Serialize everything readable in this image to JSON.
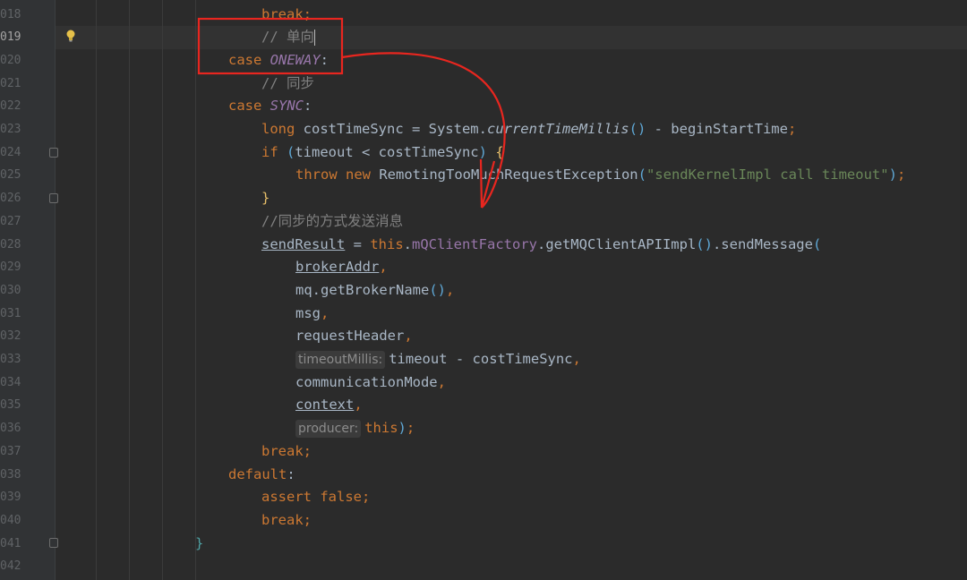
{
  "editor": {
    "lines": [
      {
        "num": "018",
        "segments": [
          {
            "t": "break",
            "c": "kw"
          },
          {
            "t": ";",
            "c": "kw"
          }
        ]
      },
      {
        "num": "019",
        "segments": [
          {
            "t": "// 单向",
            "c": "cm"
          }
        ]
      },
      {
        "num": "020",
        "segments": [
          {
            "t": "case ",
            "c": "kw"
          },
          {
            "t": "ONEWAY",
            "c": "fldi"
          },
          {
            "t": ":",
            "c": ""
          }
        ]
      },
      {
        "num": "021",
        "segments": [
          {
            "t": "// 同步",
            "c": "cm"
          }
        ]
      },
      {
        "num": "022",
        "segments": [
          {
            "t": "case ",
            "c": "kw"
          },
          {
            "t": "SYNC",
            "c": "fldi"
          },
          {
            "t": ":",
            "c": ""
          }
        ]
      },
      {
        "num": "023",
        "segments": [
          {
            "t": "long ",
            "c": "kw"
          },
          {
            "t": "costTimeSync = System.",
            "c": ""
          },
          {
            "t": "currentTimeMillis",
            "c": "mi"
          },
          {
            "t": "()",
            "c": "par2"
          },
          {
            "t": " - beginStartTime",
            "c": ""
          },
          {
            "t": ";",
            "c": "kw"
          }
        ]
      },
      {
        "num": "024",
        "segments": [
          {
            "t": "if ",
            "c": "kw"
          },
          {
            "t": "(",
            "c": "par2"
          },
          {
            "t": "timeout < costTimeSync",
            "c": ""
          },
          {
            "t": ")",
            "c": "par2"
          },
          {
            "t": " {",
            "c": "yel"
          }
        ]
      },
      {
        "num": "025",
        "segments": [
          {
            "t": "throw new ",
            "c": "kw"
          },
          {
            "t": "RemotingTooMuchRequestException",
            "c": ""
          },
          {
            "t": "(",
            "c": "par2"
          },
          {
            "t": "\"sendKernelImpl call timeout\"",
            "c": "st"
          },
          {
            "t": ")",
            "c": "par2"
          },
          {
            "t": ";",
            "c": "kw"
          }
        ]
      },
      {
        "num": "026",
        "segments": [
          {
            "t": "}",
            "c": "yel"
          }
        ]
      },
      {
        "num": "027",
        "segments": [
          {
            "t": "//同步的方式发送消息",
            "c": "cm"
          }
        ]
      },
      {
        "num": "028",
        "segments": [
          {
            "t": "sendResult",
            "c": "ul"
          },
          {
            "t": " = ",
            "c": ""
          },
          {
            "t": "this",
            "c": "kw"
          },
          {
            "t": ".",
            "c": ""
          },
          {
            "t": "mQClientFactory",
            "c": "fld"
          },
          {
            "t": ".getMQClientAPIImpl",
            "c": ""
          },
          {
            "t": "()",
            "c": "par2"
          },
          {
            "t": ".sendMessage",
            "c": ""
          },
          {
            "t": "(",
            "c": "par2"
          }
        ]
      },
      {
        "num": "029",
        "segments": [
          {
            "t": "brokerAddr",
            "c": "ul"
          },
          {
            "t": ",",
            "c": "kw"
          }
        ]
      },
      {
        "num": "030",
        "segments": [
          {
            "t": "mq.getBrokerName",
            "c": ""
          },
          {
            "t": "()",
            "c": "par2"
          },
          {
            "t": ",",
            "c": "kw"
          }
        ]
      },
      {
        "num": "031",
        "segments": [
          {
            "t": "msg",
            "c": ""
          },
          {
            "t": ",",
            "c": "kw"
          }
        ]
      },
      {
        "num": "032",
        "segments": [
          {
            "t": "requestHeader",
            "c": ""
          },
          {
            "t": ",",
            "c": "kw"
          }
        ]
      },
      {
        "num": "033",
        "segments": [
          {
            "hint": "timeoutMillis:"
          },
          {
            "t": "timeout - costTimeSync",
            "c": ""
          },
          {
            "t": ",",
            "c": "kw"
          }
        ]
      },
      {
        "num": "034",
        "segments": [
          {
            "t": "communicationMode",
            "c": ""
          },
          {
            "t": ",",
            "c": "kw"
          }
        ]
      },
      {
        "num": "035",
        "segments": [
          {
            "t": "context",
            "c": "ul"
          },
          {
            "t": ",",
            "c": "kw"
          }
        ]
      },
      {
        "num": "036",
        "segments": [
          {
            "hint": "producer:"
          },
          {
            "t": "this",
            "c": "kw"
          },
          {
            "t": ")",
            "c": "par2"
          },
          {
            "t": ";",
            "c": "kw"
          }
        ]
      },
      {
        "num": "037",
        "segments": [
          {
            "t": "break",
            "c": "kw"
          },
          {
            "t": ";",
            "c": "kw"
          }
        ]
      },
      {
        "num": "038",
        "segments": [
          {
            "t": "default",
            "c": "kw"
          },
          {
            "t": ":",
            "c": ""
          }
        ]
      },
      {
        "num": "039",
        "segments": [
          {
            "t": "assert false",
            "c": "kw"
          },
          {
            "t": ";",
            "c": "kw"
          }
        ]
      },
      {
        "num": "040",
        "segments": [
          {
            "t": "break",
            "c": "kw"
          },
          {
            "t": ";",
            "c": "kw"
          }
        ]
      },
      {
        "num": "041",
        "segments": [
          {
            "t": "}",
            "c": "teal"
          }
        ]
      },
      {
        "num": "042",
        "segments": []
      }
    ],
    "active_line": "019",
    "colors": {
      "background": "#2b2b2b",
      "keyword": "#cc7832",
      "comment": "#808080",
      "string": "#6a8759",
      "field": "#9876aa",
      "annotation_red": "#e8261f"
    },
    "icons": {
      "gutter": "lightbulb-icon",
      "fold": "fold-marker-icon"
    }
  }
}
